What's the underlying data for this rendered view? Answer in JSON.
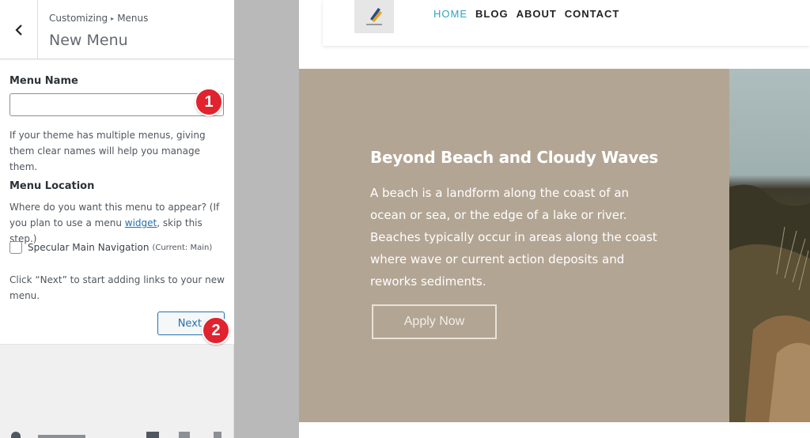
{
  "sidebar": {
    "breadcrumb": {
      "root": "Customizing",
      "section": "Menus"
    },
    "title": "New Menu",
    "menu_name": {
      "label": "Menu Name",
      "value": "",
      "help": "If your theme has multiple menus, giving them clear names will help you manage them."
    },
    "menu_location": {
      "label": "Menu Location",
      "help_before": "Where do you want this menu to appear? (If you plan to use a menu ",
      "help_link": "widget",
      "help_after": ", skip this step.)",
      "option_label": "Specular Main Navigation",
      "option_note": "(Current: Main)",
      "option_checked": false
    },
    "next_help": "Click “Next” to start adding links to your new menu.",
    "next_label": "Next"
  },
  "badges": [
    "1",
    "2"
  ],
  "preview": {
    "nav": [
      "HOME",
      "BLOG",
      "ABOUT",
      "CONTACT"
    ],
    "active_nav": "HOME",
    "hero": {
      "title": "Beyond Beach and Cloudy Waves",
      "text": "A beach is a landform along the coast of an ocean or sea, or the edge of a lake or river. Beaches typically occur in areas along the coast where wave or current action deposits and reworks sediments.",
      "button": "Apply Now"
    }
  },
  "colors": {
    "accent": "#2271b1",
    "badge": "#e0232e",
    "hero_bg": "#b3a594",
    "nav_active": "#2ea3c0"
  }
}
